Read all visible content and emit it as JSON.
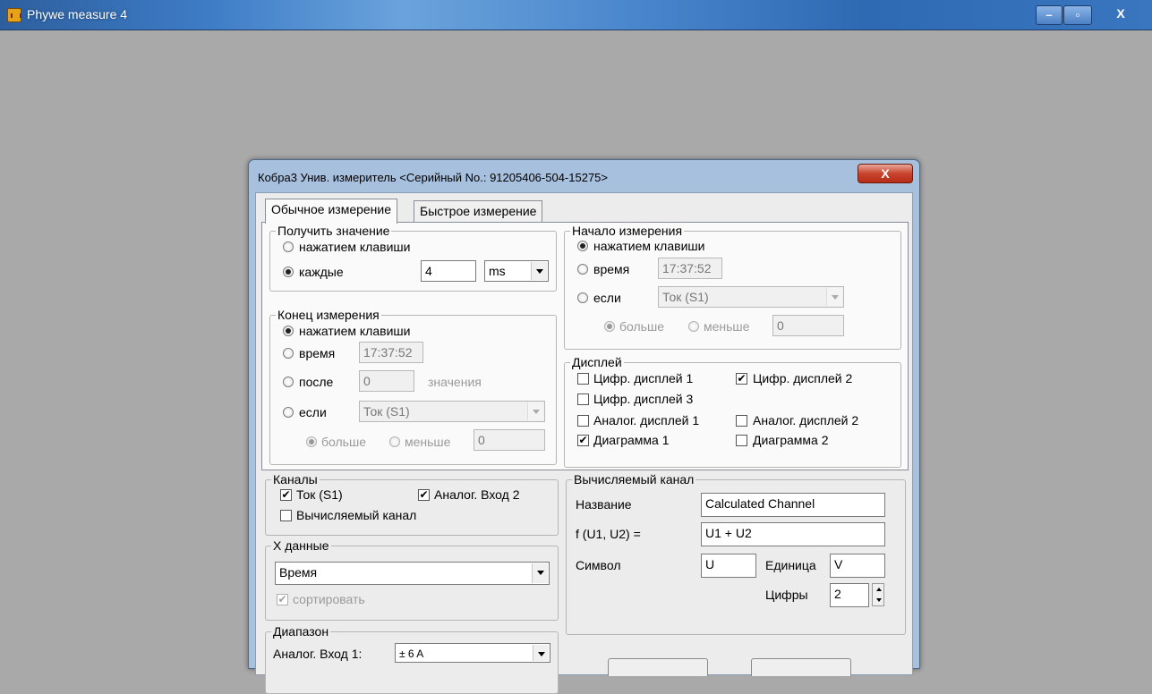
{
  "app": {
    "title": "Phywe measure 4",
    "minimize": "–",
    "maximize": "▫",
    "close": "X"
  },
  "dialog": {
    "title": "Кобра3 Унив. измеритель  <Серийный No.: 91205406-504-15275>",
    "close": "X",
    "tabs": [
      {
        "label": "Обычное измерение",
        "active": true
      },
      {
        "label": "Быстрое измерение",
        "active": false
      }
    ]
  },
  "get_value": {
    "title": "Получить значение",
    "opt_key": "нажатием клавиши",
    "opt_every": "каждые",
    "interval": "4",
    "unit": "ms"
  },
  "measure_end": {
    "title": "Конец измерения",
    "opt_key": "нажатием клавиши",
    "opt_time": "время",
    "time_value": "17:37:52",
    "opt_after": "после",
    "after_value": "0",
    "after_unit": "значения",
    "opt_if": "если",
    "if_channel": "Ток (S1)",
    "opt_more": "больше",
    "opt_less": "меньше",
    "threshold": "0"
  },
  "measure_start": {
    "title": "Начало измерения",
    "opt_key": "нажатием клавиши",
    "opt_time": "время",
    "time_value": "17:37:52",
    "opt_if": "если",
    "if_channel": "Ток (S1)",
    "opt_more": "больше",
    "opt_less": "меньше",
    "threshold": "0"
  },
  "display": {
    "title": "Дисплей",
    "items": [
      {
        "label": "Цифр. дисплей 1",
        "checked": false
      },
      {
        "label": "Цифр. дисплей 2",
        "checked": true
      },
      {
        "label": "Цифр. дисплей 3",
        "checked": false
      },
      {
        "label": "Аналог. дисплей 1",
        "checked": false
      },
      {
        "label": "Аналог. дисплей 2",
        "checked": false
      },
      {
        "label": "Диаграмма 1",
        "checked": true
      },
      {
        "label": "Диаграмма 2",
        "checked": false
      }
    ]
  },
  "channels": {
    "title": "Каналы",
    "items": [
      {
        "label": "Ток (S1)",
        "checked": true
      },
      {
        "label": "Аналог. Вход 2",
        "checked": true
      },
      {
        "label": "Вычисляемый канал",
        "checked": false
      }
    ]
  },
  "x_data": {
    "title": "X данные",
    "selected": "Время",
    "sort_label": "сортировать",
    "sort_checked": true
  },
  "range": {
    "title": "Диапазон",
    "input1_label": "Аналог. Вход 1:",
    "input1_value": "± 6 A"
  },
  "calc_channel": {
    "title": "Вычисляемый канал",
    "name_label": "Название",
    "name_value": "Calculated Channel",
    "formula_label": "f (U1, U2) =",
    "formula_value": "U1 + U2",
    "symbol_label": "Символ",
    "symbol_value": "U",
    "unit_label": "Единица",
    "unit_value": "V",
    "digits_label": "Цифры",
    "digits_value": "2"
  },
  "check_mark": "✔"
}
